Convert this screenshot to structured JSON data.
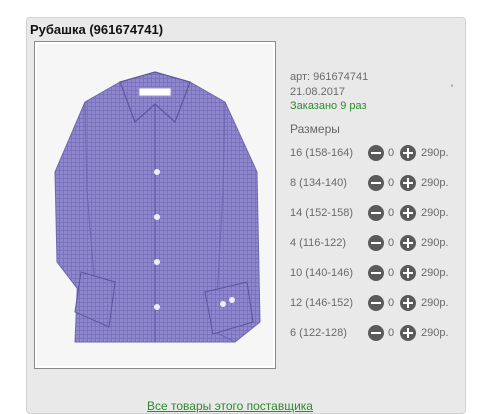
{
  "product": {
    "title": "Рубашка (961674741)",
    "art": "арт: 961674741",
    "date": "21.08.2017",
    "mark": "'",
    "ordered": "Заказано 9 раз",
    "sizes_heading": "Размеры"
  },
  "sizes": [
    {
      "label": "16 (158-164)",
      "qty": "0",
      "price": "290р."
    },
    {
      "label": "8 (134-140)",
      "qty": "0",
      "price": "290р."
    },
    {
      "label": "14 (152-158)",
      "qty": "0",
      "price": "290р."
    },
    {
      "label": "4 (116-122)",
      "qty": "0",
      "price": "290р."
    },
    {
      "label": "10 (140-146)",
      "qty": "0",
      "price": "290р."
    },
    {
      "label": "12 (146-152)",
      "qty": "0",
      "price": "290р."
    },
    {
      "label": "6 (122-128)",
      "qty": "0",
      "price": "290р."
    }
  ],
  "footer": {
    "link": "Все товары этого поставщика"
  },
  "colors": {
    "accent_green": "#2c8c2c",
    "shirt": "#8b84c9",
    "button": "#5a5a5a"
  }
}
